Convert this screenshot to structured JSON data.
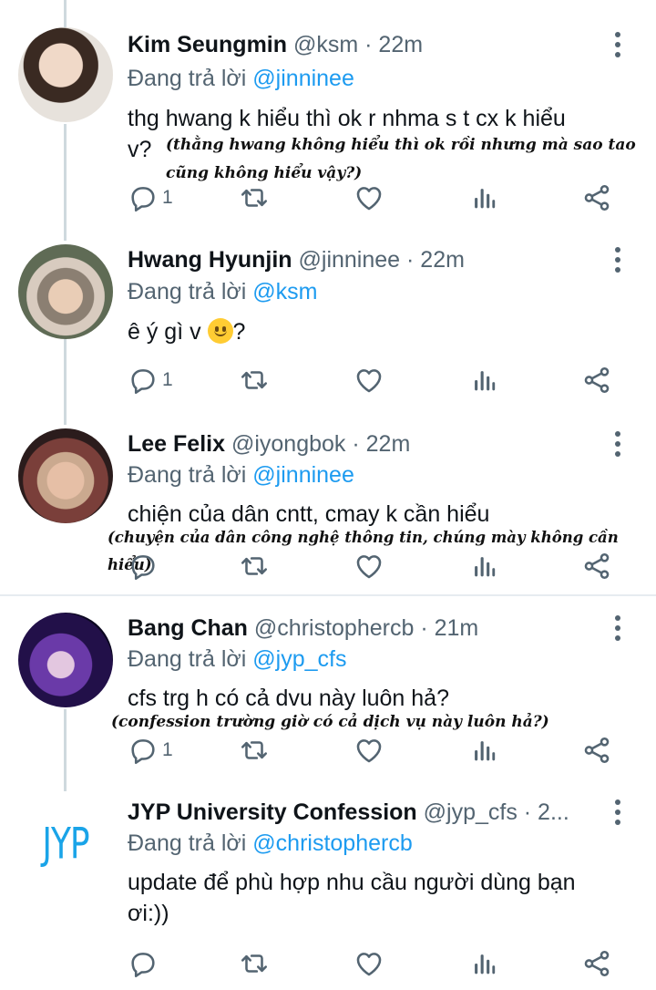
{
  "thread": {
    "tweets": [
      {
        "name": "Kim Seungmin",
        "handle": "@ksm",
        "time": "· 22m",
        "reply_label": "Đang trả lời",
        "reply_to": "@jinninee",
        "text_line1": "thg hwang k hiểu thì ok r nhma s t cx k hiểu",
        "text_line2": "v?",
        "translation_line1": "(thằng hwang không hiểu thì ok rồi nhưng mà sao tao",
        "translation_line2": "cũng không hiểu vậy?)",
        "reply_count": "1",
        "avatar_icon": "user-photo-avatar"
      },
      {
        "name": "Hwang Hyunjin",
        "handle": "@jinninee",
        "time": "· 22m",
        "reply_label": "Đang trả lời",
        "reply_to": "@ksm",
        "text_before_emoji": "ê ý gì v ",
        "emoji": "slightly-smiling-face-emoji",
        "text_after_emoji": "?",
        "reply_count": "1",
        "avatar_icon": "user-photo-avatar"
      },
      {
        "name": "Lee Felix",
        "handle": "@iyongbok",
        "time": "· 22m",
        "reply_label": "Đang trả lời",
        "reply_to": "@jinninee",
        "text": "chiện của dân cntt, cmay k cần hiểu",
        "translation": "(chuyện của dân công nghệ thông tin, chúng mày không cần hiểu)",
        "reply_count": "",
        "avatar_icon": "user-photo-avatar"
      },
      {
        "name": "Bang Chan",
        "handle": "@christophercb",
        "time": "· 21m",
        "reply_label": "Đang trả lời",
        "reply_to": "@jyp_cfs",
        "text": "cfs trg h có cả dvu này luôn hả?",
        "translation": "(confession trường giờ có cả dịch vụ này luôn hả?)",
        "reply_count": "1",
        "avatar_icon": "user-photo-avatar"
      },
      {
        "name": "JYP University Confession",
        "handle": "@jyp_cfs · 2...",
        "reply_label": "Đang trả lời",
        "reply_to": "@christophercb",
        "text_line1": "update để phù hợp nhu cầu người dùng bạn",
        "text_line2": "ơi:))",
        "reply_count": "",
        "avatar_logo_text": "JYP"
      }
    ]
  },
  "colors": {
    "accent": "#1d9bf0",
    "secondary_text": "#536471",
    "thread_line": "#cfd9de",
    "logo": "#1aa4e8"
  }
}
